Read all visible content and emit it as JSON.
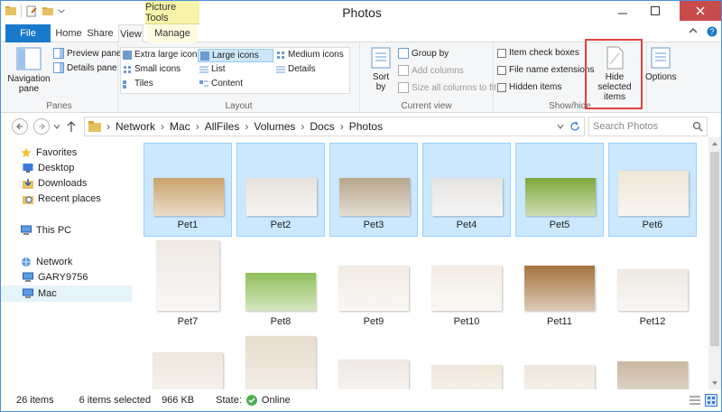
{
  "window": {
    "title": "Photos",
    "context_tab_label": "Picture Tools"
  },
  "tabs": [
    {
      "label": "File"
    },
    {
      "label": "Home"
    },
    {
      "label": "Share"
    },
    {
      "label": "View"
    },
    {
      "label": "Manage"
    }
  ],
  "ribbon": {
    "panes": {
      "label": "Panes",
      "navigation_pane": "Navigation",
      "navigation_pane_2": "pane",
      "preview_pane": "Preview pane",
      "details_pane": "Details pane"
    },
    "layout": {
      "label": "Layout",
      "options": [
        "Extra large icons",
        "Large icons",
        "Medium icons",
        "Small icons",
        "List",
        "Details",
        "Tiles",
        "Content"
      ],
      "selected": "Large icons"
    },
    "current_view": {
      "label": "Current view",
      "sort_by": "Sort",
      "sort_by_2": "by",
      "group_by": "Group by",
      "add_columns": "Add columns",
      "size_all_columns": "Size all columns to fit"
    },
    "show_hide": {
      "label": "Show/hide",
      "item_check_boxes": "Item check boxes",
      "file_name_extensions": "File name extensions",
      "hidden_items": "Hidden items",
      "hide_selected": "Hide selected",
      "hide_selected_2": "items"
    },
    "options": "Options"
  },
  "address": {
    "crumbs": [
      "Network",
      "Mac",
      "AllFiles",
      "Volumes",
      "Docs",
      "Photos"
    ],
    "search_placeholder": "Search Photos"
  },
  "nav": {
    "favorites": "Favorites",
    "desktop": "Desktop",
    "downloads": "Downloads",
    "recent": "Recent places",
    "this_pc": "This PC",
    "network": "Network",
    "gary": "GARY9756",
    "mac": "Mac"
  },
  "files": [
    {
      "name": "Pet1",
      "selected": true,
      "color": "#c9a26b"
    },
    {
      "name": "Pet2",
      "selected": true,
      "color": "#e8e2dc"
    },
    {
      "name": "Pet3",
      "selected": true,
      "color": "#b8a48a"
    },
    {
      "name": "Pet4",
      "selected": true,
      "color": "#e6e4e2"
    },
    {
      "name": "Pet5",
      "selected": true,
      "color": "#7ea83a"
    },
    {
      "name": "Pet6",
      "selected": true,
      "color": "#f0e6d8"
    },
    {
      "name": "Pet7",
      "selected": false,
      "color": "#efe9e4"
    },
    {
      "name": "Pet8",
      "selected": false,
      "color": "#8fbf5a"
    },
    {
      "name": "Pet9",
      "selected": false,
      "color": "#f2ebe3"
    },
    {
      "name": "Pet10",
      "selected": false,
      "color": "#f3ece4"
    },
    {
      "name": "Pet11",
      "selected": false,
      "color": "#a4733f"
    },
    {
      "name": "Pet12",
      "selected": false,
      "color": "#eee8e2"
    },
    {
      "name": "",
      "selected": false,
      "color": "#efe6dc"
    },
    {
      "name": "",
      "selected": false,
      "color": "#e8dccd"
    },
    {
      "name": "",
      "selected": false,
      "color": "#efe9e4"
    },
    {
      "name": "",
      "selected": false,
      "color": "#f0e6da"
    },
    {
      "name": "",
      "selected": false,
      "color": "#efe6dc"
    },
    {
      "name": "",
      "selected": false,
      "color": "#c9b7a0"
    }
  ],
  "status": {
    "item_count": "26 items",
    "selected": "6 items selected",
    "size": "966 KB",
    "state_label": "State:",
    "state_value": "Online"
  }
}
